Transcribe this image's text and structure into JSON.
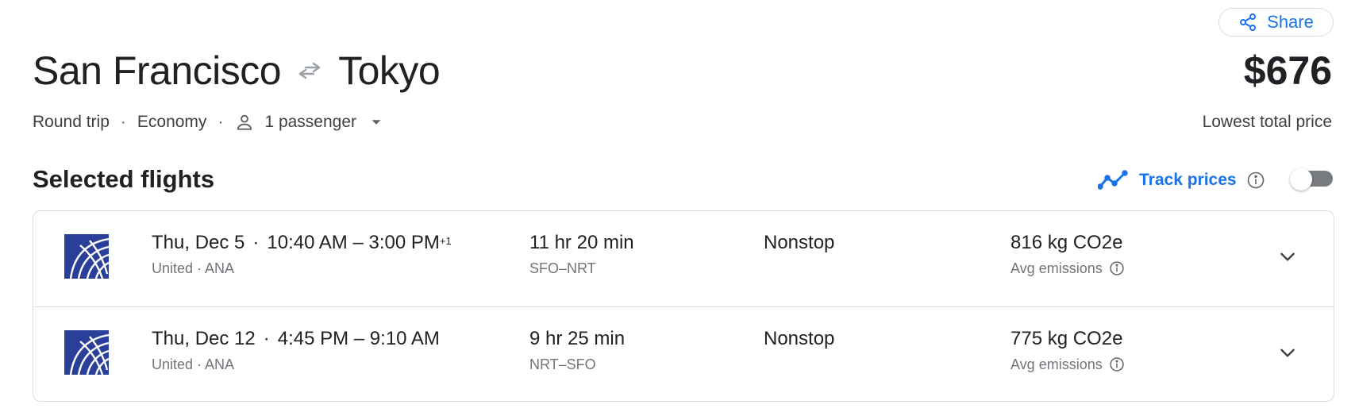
{
  "share": {
    "label": "Share",
    "icon": "share-icon"
  },
  "route": {
    "origin": "San Francisco",
    "destination": "Tokyo",
    "swap_icon": "swap-arrows-icon"
  },
  "price": {
    "amount": "$676",
    "label": "Lowest total price"
  },
  "trip": {
    "type": "Round trip",
    "cabin": "Economy",
    "separator": "·",
    "passengers": "1 passenger",
    "person_icon": "person-icon",
    "caret_icon": "caret-down-icon"
  },
  "section": {
    "title": "Selected flights"
  },
  "track": {
    "label": "Track prices",
    "icon": "trend-line-icon",
    "info_icon": "info-icon",
    "enabled": false
  },
  "flights": [
    {
      "date": "Thu, Dec 5",
      "dot": "·",
      "times": "10:40 AM – 3:00 PM",
      "day_offset": "+1",
      "airlines": "United · ANA",
      "duration": "11 hr 20 min",
      "route": "SFO–NRT",
      "stops": "Nonstop",
      "emissions": "816 kg CO2e",
      "emissions_label": "Avg emissions"
    },
    {
      "date": "Thu, Dec 12",
      "dot": "·",
      "times": "4:45 PM – 9:10 AM",
      "day_offset": "",
      "airlines": "United · ANA",
      "duration": "9 hr 25 min",
      "route": "NRT–SFO",
      "stops": "Nonstop",
      "emissions": "775 kg CO2e",
      "emissions_label": "Avg emissions"
    }
  ],
  "colors": {
    "accent": "#1a73e8",
    "text_primary": "#202124",
    "text_secondary": "#70757a",
    "border": "#dadce0",
    "united_blue": "#2a3f9a"
  }
}
